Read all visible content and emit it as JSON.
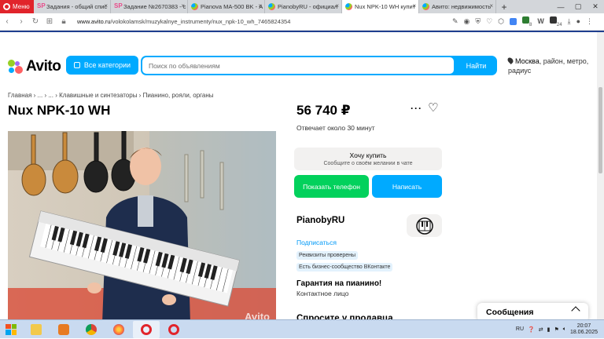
{
  "browser": {
    "menu_label": "Меню",
    "tabs": [
      {
        "label": "Задания - общий спис",
        "icon": "sp-icon"
      },
      {
        "label": "Задание №2670383 - с",
        "icon": "sp-icon"
      },
      {
        "label": "Pianova MA-500 BK - А",
        "icon": "avito-icon"
      },
      {
        "label": "PianobyRU - официал",
        "icon": "avito-icon"
      },
      {
        "label": "Nux NPK-10 WH купит",
        "icon": "avito-icon",
        "active": true
      },
      {
        "label": "Авито: недвижимость",
        "icon": "avito-icon"
      }
    ],
    "url_domain": "www.avito.ru",
    "url_path": "/volokolamsk/muzykalnye_instrumenty/nux_npk-10_wh_7465824354",
    "ext_badges": [
      "8",
      "24"
    ]
  },
  "header": {
    "logo_text": "Avito",
    "categories_label": "Все категории",
    "search_placeholder": "Поиск по объявлениям",
    "search_button": "Найти",
    "location_city": "Москва",
    "location_rest": ", район, метро, радиус"
  },
  "breadcrumb": "Главная › ... › ... › Клавишные и синтезаторы › Пианино, рояли, органы",
  "listing": {
    "title": "Nux NPK-10 WH",
    "price": "56 740 ₽",
    "reply_time": "Отвечает около 30 минут",
    "want_title": "Хочу купить",
    "want_sub": "Сообщите о своём желании в чате",
    "show_phone": "Показать телефон",
    "write": "Написать",
    "watermark": "Avito"
  },
  "seller": {
    "name": "PianobyRU",
    "subscribe": "Подписаться",
    "badge1": "Реквизиты проверены",
    "badge2": "Есть бизнес-сообщество ВКонтакте",
    "guarantee": "Гарантия на пианино!",
    "contact": "Контактное лицо",
    "ask": "Спросите у продавца"
  },
  "messages_widget": "Сообщения",
  "taskbar": {
    "lang": "RU",
    "time": "20:07",
    "date": "18.06.2025"
  },
  "colors": {
    "avito_blue": "#00aaff",
    "green": "#02d15c",
    "opera_red": "#e1242b"
  }
}
